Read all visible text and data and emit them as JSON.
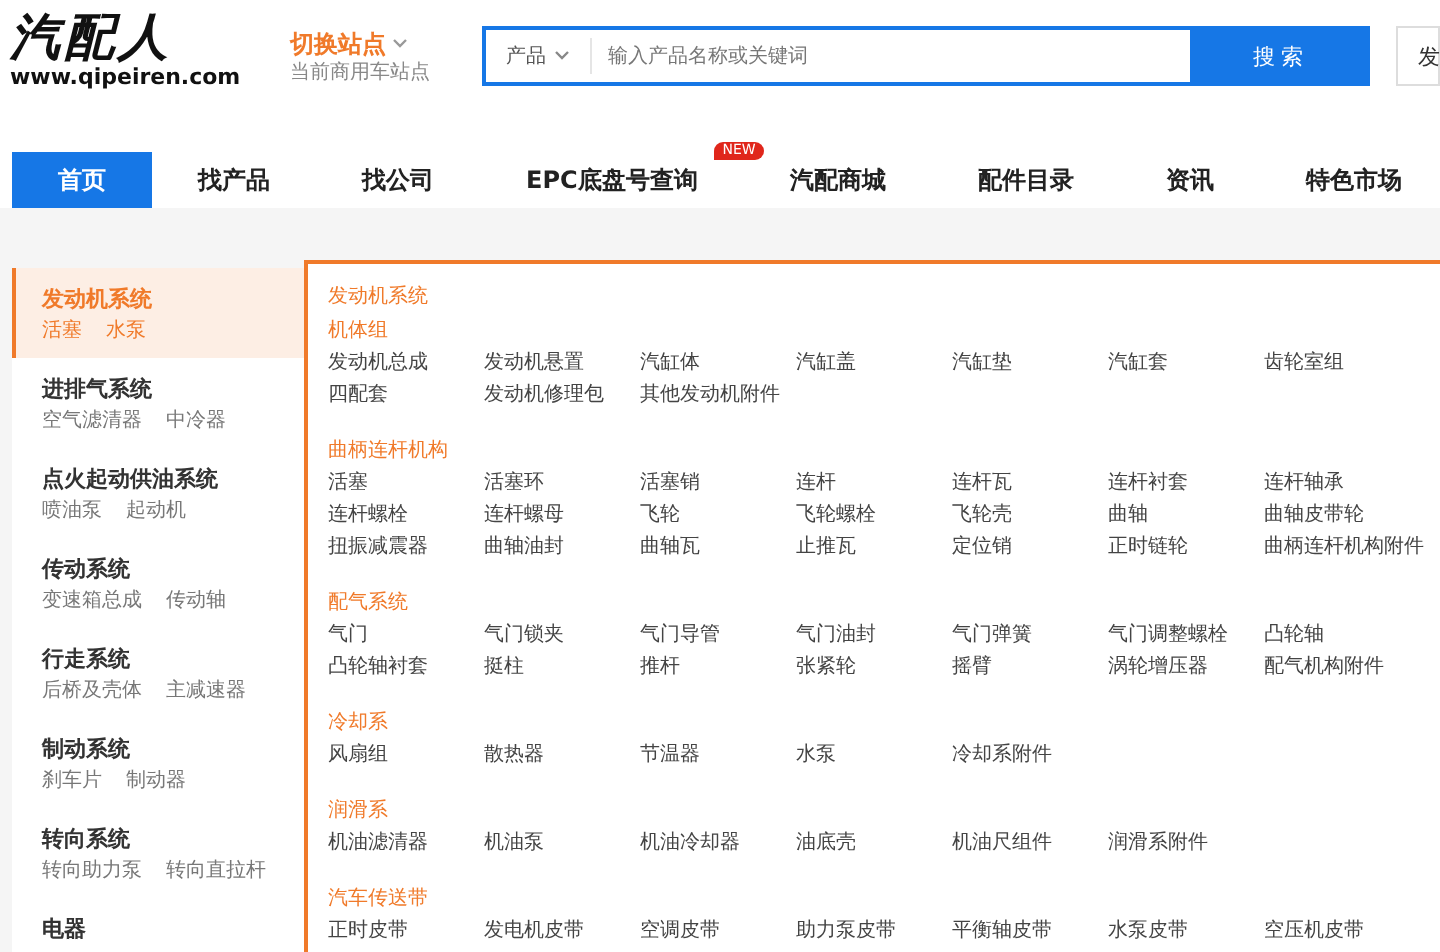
{
  "header": {
    "logo": {
      "name": "汽配人",
      "url": "www.qipeiren.com"
    },
    "site_switch": {
      "title": "切换站点",
      "expanded": false,
      "subtitle": "当前商用车站点"
    },
    "search": {
      "category": "产品",
      "placeholder": "输入产品名称或关键词",
      "button": "搜 索"
    },
    "extra_button": "发"
  },
  "nav": [
    {
      "label": "首页",
      "selected": true
    },
    {
      "label": "找产品",
      "selected": false
    },
    {
      "label": "找公司",
      "selected": false
    },
    {
      "label": "EPC底盘号查询",
      "selected": false,
      "badge": "NEW"
    },
    {
      "label": "汽配商城",
      "selected": false
    },
    {
      "label": "配件目录",
      "selected": false
    },
    {
      "label": "资讯",
      "selected": false
    },
    {
      "label": "特色市场",
      "selected": false
    }
  ],
  "sidebar": [
    {
      "title": "发动机系统",
      "selected": true,
      "items": [
        "活塞",
        "水泵"
      ]
    },
    {
      "title": "进排气系统",
      "selected": false,
      "items": [
        "空气滤清器",
        "中冷器"
      ]
    },
    {
      "title": "点火起动供油系统",
      "selected": false,
      "items": [
        "喷油泵",
        "起动机"
      ]
    },
    {
      "title": "传动系统",
      "selected": false,
      "items": [
        "变速箱总成",
        "传动轴"
      ]
    },
    {
      "title": "行走系统",
      "selected": false,
      "items": [
        "后桥及壳体",
        "主减速器"
      ]
    },
    {
      "title": "制动系统",
      "selected": false,
      "items": [
        "刹车片",
        "制动器"
      ]
    },
    {
      "title": "转向系统",
      "selected": false,
      "items": [
        "转向助力泵",
        "转向直拉杆"
      ]
    },
    {
      "title": "电器",
      "selected": false
    }
  ],
  "panel": {
    "title": "发动机系统",
    "groups": [
      {
        "title": "机体组",
        "items": [
          "发动机总成",
          "发动机悬置",
          "汽缸体",
          "汽缸盖",
          "汽缸垫",
          "汽缸套",
          "齿轮室组",
          "四配套",
          "发动机修理包",
          "其他发动机附件"
        ]
      },
      {
        "title": "曲柄连杆机构",
        "items": [
          "活塞",
          "活塞环",
          "活塞销",
          "连杆",
          "连杆瓦",
          "连杆衬套",
          "连杆轴承",
          "连杆螺栓",
          "连杆螺母",
          "飞轮",
          "飞轮螺栓",
          "飞轮壳",
          "曲轴",
          "曲轴皮带轮",
          "扭振减震器",
          "曲轴油封",
          "曲轴瓦",
          "止推瓦",
          "定位销",
          "正时链轮",
          "曲柄连杆机构附件"
        ]
      },
      {
        "title": "配气系统",
        "items": [
          "气门",
          "气门锁夹",
          "气门导管",
          "气门油封",
          "气门弹簧",
          "气门调整螺栓",
          "凸轮轴",
          "凸轮轴衬套",
          "挺柱",
          "推杆",
          "张紧轮",
          "摇臂",
          "涡轮增压器",
          "配气机构附件"
        ]
      },
      {
        "title": "冷却系",
        "items": [
          "风扇组",
          "散热器",
          "节温器",
          "水泵",
          "冷却系附件"
        ]
      },
      {
        "title": "润滑系",
        "items": [
          "机油滤清器",
          "机油泵",
          "机油冷却器",
          "油底壳",
          "机油尺组件",
          "润滑系附件"
        ]
      },
      {
        "title": "汽车传送带",
        "items": [
          "正时皮带",
          "发电机皮带",
          "空调皮带",
          "助力泵皮带",
          "平衡轴皮带",
          "水泵皮带",
          "空压机皮带"
        ]
      }
    ]
  }
}
